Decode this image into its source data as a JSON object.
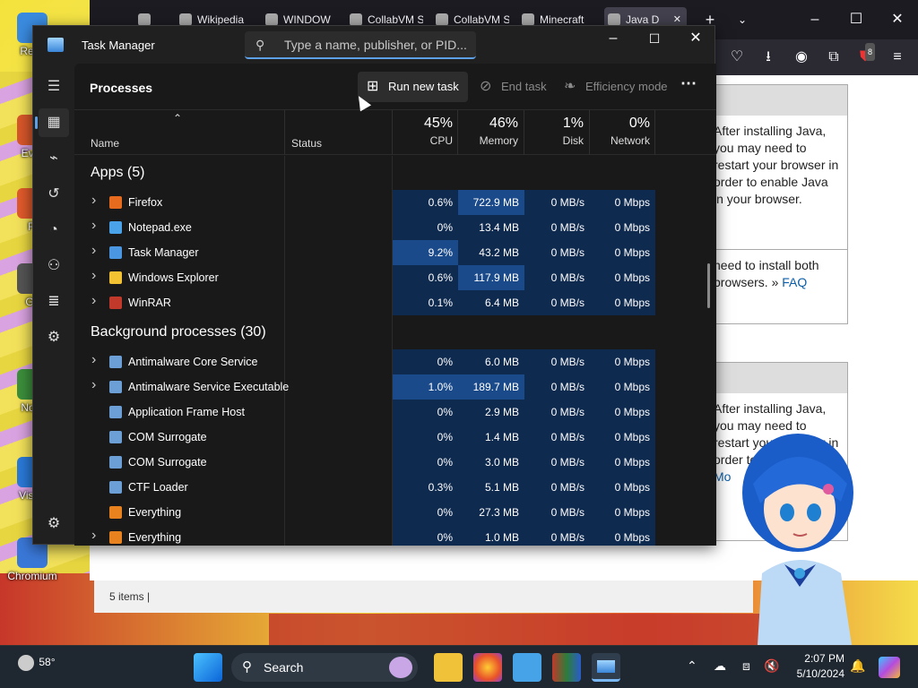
{
  "desktop": {
    "icons": [
      {
        "label": "Recy",
        "color": "#3a8be0"
      },
      {
        "label": "Ever",
        "color": "#d8572a"
      },
      {
        "label": "Fi",
        "color": "#e05a2b"
      },
      {
        "label": "Git",
        "color": "#555"
      },
      {
        "label": "Note",
        "color": "#3c8f3c"
      },
      {
        "label": "Visua",
        "color": "#2a7ad8"
      },
      {
        "label": "Chromium",
        "color": "#3a78d8"
      }
    ]
  },
  "browser": {
    "tabs": [
      {
        "label": "",
        "icon": "tab-manager-icon",
        "active": false
      },
      {
        "label": "Wikipedia",
        "icon": "wikipedia-icon",
        "active": false
      },
      {
        "label": "WINDOW",
        "icon": "window-icon",
        "active": false
      },
      {
        "label": "CollabVM Se",
        "icon": "",
        "active": false
      },
      {
        "label": "CollabVM Se",
        "icon": "",
        "active": false
      },
      {
        "label": "Minecraft",
        "icon": "minecraft-icon",
        "active": false
      },
      {
        "label": "Java D",
        "icon": "java-icon",
        "active": true
      }
    ],
    "extension_badge": "8",
    "java_boxes": [
      {
        "text": "After installing Java, you may need to restart your browser in order to enable Java in your browser."
      },
      {
        "text": "need to install both browsers. » ",
        "link": "FAQ"
      },
      {
        "text": "After installing Java, you may need to restart your browser in order to enable Java",
        "link": "» Mo"
      }
    ],
    "status_text": "5 items"
  },
  "task_manager": {
    "title": "Task Manager",
    "search_placeholder": "Type a name, publisher, or PID...",
    "page_title": "Processes",
    "commands": {
      "run": "Run new task",
      "end": "End task",
      "efficiency": "Efficiency mode"
    },
    "columns": {
      "name": "Name",
      "status": "Status",
      "cpu": {
        "pct": "45%",
        "label": "CPU"
      },
      "memory": {
        "pct": "46%",
        "label": "Memory"
      },
      "disk": {
        "pct": "1%",
        "label": "Disk"
      },
      "network": {
        "pct": "0%",
        "label": "Network"
      }
    },
    "sections": {
      "apps": "Apps (5)",
      "background": "Background processes (30)"
    },
    "apps": [
      {
        "name": "Firefox",
        "expand": true,
        "icon": "#e66b1f",
        "cpu": "0.6%",
        "memory": "722.9 MB",
        "disk": "0 MB/s",
        "network": "0 Mbps",
        "cpu_hi": false,
        "mem_hi": true
      },
      {
        "name": "Notepad.exe",
        "expand": true,
        "icon": "#4aa3e8",
        "cpu": "0%",
        "memory": "13.4 MB",
        "disk": "0 MB/s",
        "network": "0 Mbps",
        "cpu_hi": false,
        "mem_hi": false
      },
      {
        "name": "Task Manager",
        "expand": true,
        "icon": "#4a96e0",
        "cpu": "9.2%",
        "memory": "43.2 MB",
        "disk": "0 MB/s",
        "network": "0 Mbps",
        "cpu_hi": true,
        "mem_hi": false
      },
      {
        "name": "Windows Explorer",
        "expand": true,
        "icon": "#f2c233",
        "cpu": "0.6%",
        "memory": "117.9 MB",
        "disk": "0 MB/s",
        "network": "0 Mbps",
        "cpu_hi": false,
        "mem_hi": true
      },
      {
        "name": "WinRAR",
        "expand": true,
        "icon": "#c0392b",
        "cpu": "0.1%",
        "memory": "6.4 MB",
        "disk": "0 MB/s",
        "network": "0 Mbps",
        "cpu_hi": false,
        "mem_hi": false
      }
    ],
    "background": [
      {
        "name": "Antimalware Core Service",
        "expand": true,
        "icon": "#6c9fd6",
        "cpu": "0%",
        "memory": "6.0 MB",
        "disk": "0 MB/s",
        "network": "0 Mbps",
        "cpu_hi": false,
        "mem_hi": false
      },
      {
        "name": "Antimalware Service Executable",
        "expand": true,
        "icon": "#6c9fd6",
        "cpu": "1.0%",
        "memory": "189.7 MB",
        "disk": "0 MB/s",
        "network": "0 Mbps",
        "cpu_hi": true,
        "mem_hi": true
      },
      {
        "name": "Application Frame Host",
        "expand": false,
        "icon": "#6c9fd6",
        "cpu": "0%",
        "memory": "2.9 MB",
        "disk": "0 MB/s",
        "network": "0 Mbps",
        "cpu_hi": false,
        "mem_hi": false
      },
      {
        "name": "COM Surrogate",
        "expand": false,
        "icon": "#6c9fd6",
        "cpu": "0%",
        "memory": "1.4 MB",
        "disk": "0 MB/s",
        "network": "0 Mbps",
        "cpu_hi": false,
        "mem_hi": false
      },
      {
        "name": "COM Surrogate",
        "expand": false,
        "icon": "#6c9fd6",
        "cpu": "0%",
        "memory": "3.0 MB",
        "disk": "0 MB/s",
        "network": "0 Mbps",
        "cpu_hi": false,
        "mem_hi": false
      },
      {
        "name": "CTF Loader",
        "expand": false,
        "icon": "#6c9fd6",
        "cpu": "0.3%",
        "memory": "5.1 MB",
        "disk": "0 MB/s",
        "network": "0 Mbps",
        "cpu_hi": false,
        "mem_hi": false
      },
      {
        "name": "Everything",
        "expand": false,
        "icon": "#e8821f",
        "cpu": "0%",
        "memory": "27.3 MB",
        "disk": "0 MB/s",
        "network": "0 Mbps",
        "cpu_hi": false,
        "mem_hi": false
      },
      {
        "name": "Everything",
        "expand": true,
        "icon": "#e8821f",
        "cpu": "0%",
        "memory": "1.0 MB",
        "disk": "0 MB/s",
        "network": "0 Mbps",
        "cpu_hi": false,
        "mem_hi": false
      }
    ],
    "colors": {
      "cell": "#0f2a4f",
      "cell_hi": "#1b4a8a",
      "accent": "#5ea0e6"
    }
  },
  "taskbar": {
    "weather": "58°",
    "search_label": "Search",
    "time": "2:07 PM",
    "date": "5/10/2024"
  }
}
